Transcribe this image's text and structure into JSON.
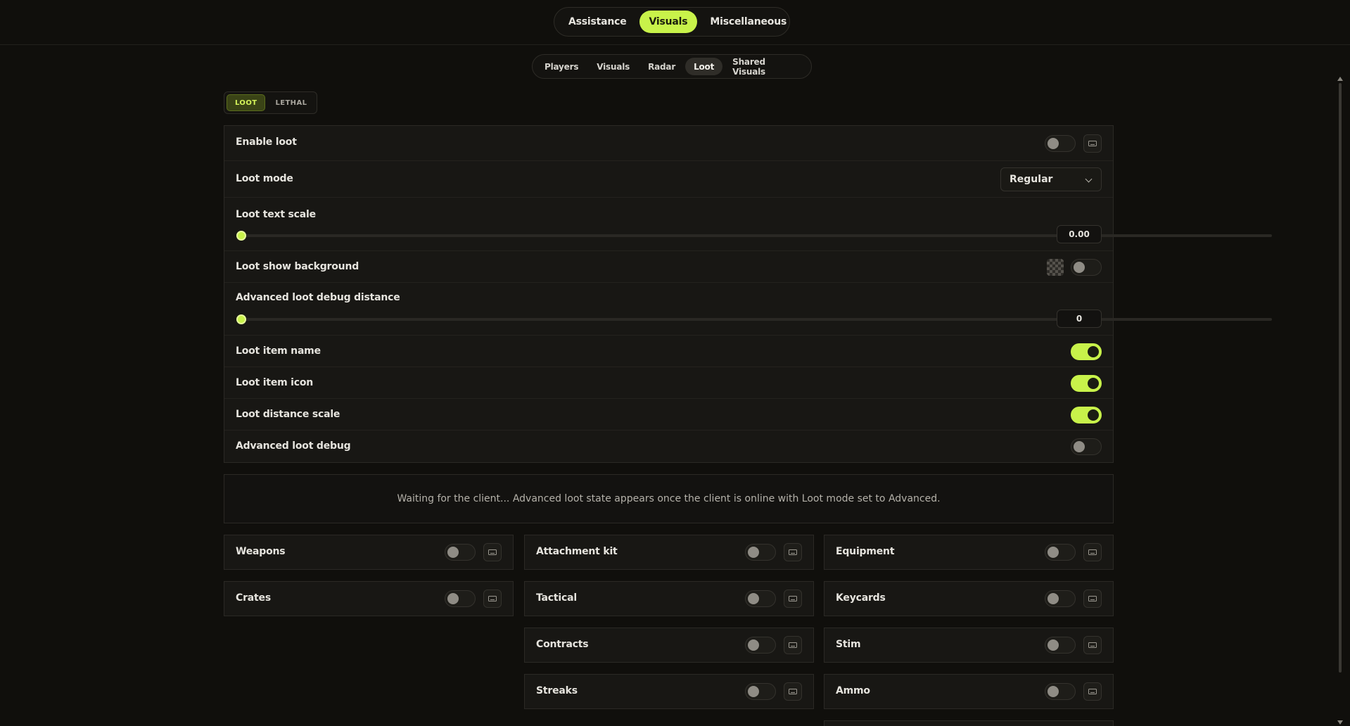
{
  "colors": {
    "accent": "#c8f24a",
    "background": "#100f0c",
    "panel": "#181714"
  },
  "main_tabs": [
    {
      "label": "Assistance",
      "active": false
    },
    {
      "label": "Visuals",
      "active": true
    },
    {
      "label": "Miscellaneous",
      "active": false
    }
  ],
  "sub_tabs": [
    {
      "label": "Players",
      "active": false
    },
    {
      "label": "Visuals",
      "active": false
    },
    {
      "label": "Radar",
      "active": false
    },
    {
      "label": "Loot",
      "active": true
    },
    {
      "label": "Shared Visuals",
      "active": false
    }
  ],
  "segment": [
    {
      "label": "LOOT",
      "active": true
    },
    {
      "label": "LETHAL",
      "active": false
    }
  ],
  "settings": {
    "enable_loot": {
      "label": "Enable loot",
      "on": false
    },
    "loot_mode": {
      "label": "Loot mode",
      "value": "Regular"
    },
    "loot_text_scale": {
      "label": "Loot text scale",
      "value": "0.00",
      "fraction": 0
    },
    "loot_show_background": {
      "label": "Loot show background",
      "on": false
    },
    "advanced_loot_debug_distance": {
      "label": "Advanced loot debug distance",
      "value": "0",
      "fraction": 0
    },
    "loot_item_name": {
      "label": "Loot item name",
      "on": true
    },
    "loot_item_icon": {
      "label": "Loot item icon",
      "on": true
    },
    "loot_distance_scale": {
      "label": "Loot distance scale",
      "on": true
    },
    "advanced_loot_debug": {
      "label": "Advanced loot debug",
      "on": false
    }
  },
  "info_message": "Waiting for the client... Advanced loot state appears once the client is online with Loot mode set to Advanced.",
  "categories": {
    "col1": [
      {
        "label": "Weapons",
        "on": false
      },
      {
        "label": "Crates",
        "on": false
      }
    ],
    "col2": [
      {
        "label": "Attachment kit",
        "on": false
      },
      {
        "label": "Tactical",
        "on": false
      },
      {
        "label": "Contracts",
        "on": false
      },
      {
        "label": "Streaks",
        "on": false
      }
    ],
    "col3": [
      {
        "label": "Equipment",
        "on": false
      },
      {
        "label": "Keycards",
        "on": false
      },
      {
        "label": "Stim",
        "on": false
      },
      {
        "label": "Ammo",
        "on": false
      }
    ]
  },
  "icons": {
    "keybind": "keyboard-icon",
    "chevron": "chevron-down-icon",
    "background": "checkerboard-icon"
  }
}
